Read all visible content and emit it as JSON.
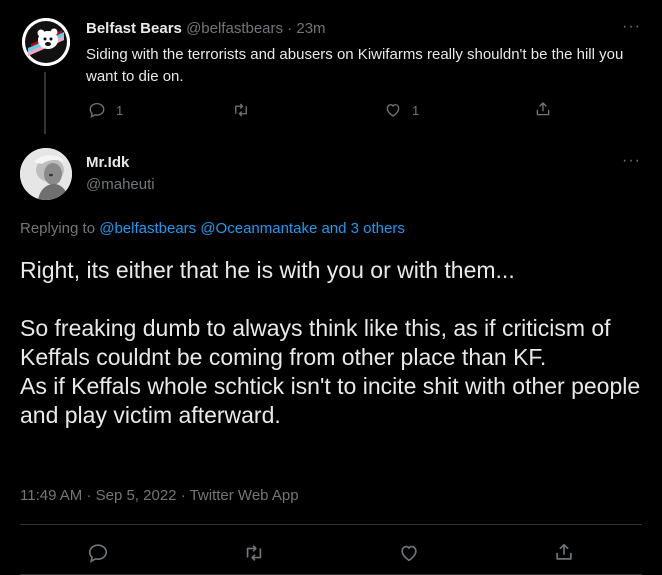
{
  "parent_tweet": {
    "display_name": "Belfast Bears",
    "handle": "@belfastbears",
    "separator": "·",
    "time": "23m",
    "text": "Siding with the terrorists and abusers on Kiwifarms really shouldn't be the hill you want to die on.",
    "reply_count": "1",
    "like_count": "1",
    "more_label": "···"
  },
  "main_tweet": {
    "display_name": "Mr.Idk",
    "handle": "@maheuti",
    "more_label": "···",
    "replying_prefix": "Replying to",
    "replying_to": "@belfastbears @Oceanmantake and 3 others",
    "body_lines": [
      "Right, its either that he is with you or with them...",
      "",
      "So freaking dumb to always think like this, as if criticism of Keffals couldnt be coming from other place than KF.",
      "As if Keffals whole schtick isn't to incite shit with other people and play victim afterward."
    ],
    "time": "11:49 AM",
    "date": "Sep 5, 2022",
    "source": "Twitter Web App",
    "meta_separator": "·"
  },
  "colors": {
    "background": "#000000",
    "text": "#e7e9ea",
    "muted": "#71767b",
    "link": "#1d9bf0",
    "divider": "#2f3336"
  }
}
